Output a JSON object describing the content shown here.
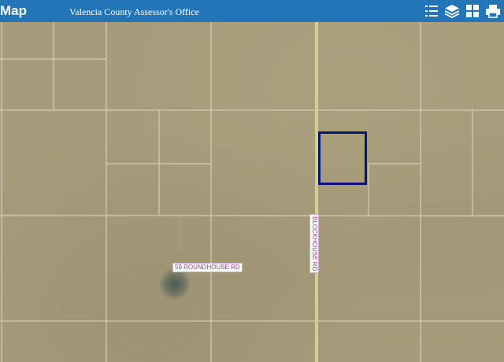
{
  "header": {
    "app_title": "Map",
    "subtitle": "Valencia County Assessor's Office",
    "tools": [
      {
        "name": "legend",
        "icon": "list-icon"
      },
      {
        "name": "layers",
        "icon": "layers-icon"
      },
      {
        "name": "basemap-gallery",
        "icon": "grid-icon"
      },
      {
        "name": "print",
        "icon": "printer-icon"
      }
    ]
  },
  "map": {
    "road_labels": {
      "vertical": "BLOCKHOUSE RD",
      "horizontal": "59 ROUNDHOUSE RD"
    },
    "highlight_color": "#0b127a",
    "parcel_line_color": "#e8e3d2",
    "road_color": "#d8d19a"
  }
}
